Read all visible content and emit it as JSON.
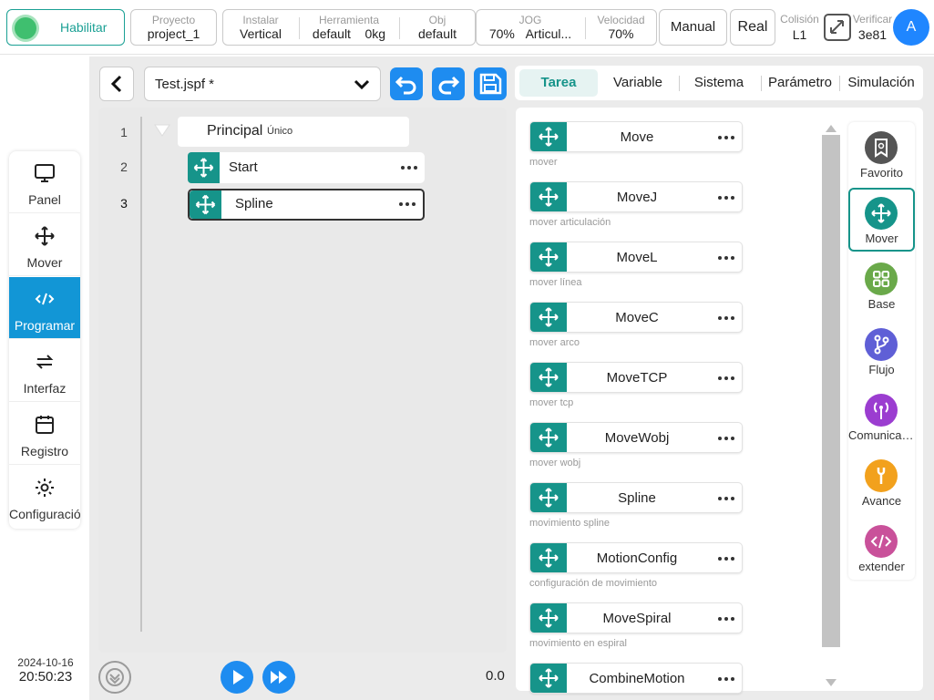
{
  "topbar": {
    "enable_label": "Habilitar",
    "project": {
      "label": "Proyecto",
      "value": "project_1"
    },
    "install": {
      "label": "Instalar",
      "value": "Vertical"
    },
    "tool": {
      "label": "Herramienta",
      "value": "default",
      "weight": "0kg"
    },
    "obj": {
      "label": "Obj",
      "value": "default"
    },
    "jog": {
      "label": "JOG",
      "value": "70%",
      "mode": "Articul..."
    },
    "speed": {
      "label": "Velocidad",
      "value": "70%"
    },
    "manual_label": "Manual",
    "real_label": "Real",
    "collision": {
      "label": "Colisión",
      "value": "L1"
    },
    "verify": {
      "label": "Verificar",
      "value": "3e81"
    },
    "avatar_letter": "A"
  },
  "leftnav": {
    "items": [
      {
        "label": "Panel",
        "icon": "monitor-icon"
      },
      {
        "label": "Mover",
        "icon": "move-icon"
      },
      {
        "label": "Programar",
        "icon": "code-icon",
        "active": true
      },
      {
        "label": "Interfaz",
        "icon": "swap-icon"
      },
      {
        "label": "Registro",
        "icon": "calendar-icon"
      },
      {
        "label": "Configuración",
        "icon": "gear-icon"
      }
    ],
    "date": "2024-10-16",
    "time": "20:50:23"
  },
  "editor": {
    "file_name": "Test.jspf *",
    "line_numbers": [
      "1",
      "2",
      "3"
    ],
    "root": {
      "name": "Principal",
      "tag": "Único"
    },
    "nodes": [
      {
        "name": "Start"
      },
      {
        "name": "Spline",
        "selected": true
      }
    ],
    "speed_value": "0.0"
  },
  "tabs": [
    "Tarea",
    "Variable",
    "Sistema",
    "Parámetro",
    "Simulación"
  ],
  "commands": [
    {
      "name": "Move",
      "desc": "mover"
    },
    {
      "name": "MoveJ",
      "desc": "mover articulación"
    },
    {
      "name": "MoveL",
      "desc": "mover línea"
    },
    {
      "name": "MoveC",
      "desc": "mover arco"
    },
    {
      "name": "MoveTCP",
      "desc": "mover tcp"
    },
    {
      "name": "MoveWobj",
      "desc": "mover wobj"
    },
    {
      "name": "Spline",
      "desc": "movimiento spline"
    },
    {
      "name": "MotionConfig",
      "desc": "configuración de movimiento"
    },
    {
      "name": "MoveSpiral",
      "desc": "movimiento en espiral"
    },
    {
      "name": "CombineMotion",
      "desc": ""
    }
  ],
  "categories": [
    {
      "label": "Favorito",
      "color": "#555555",
      "icon": "bookmark-icon"
    },
    {
      "label": "Mover",
      "color": "#16948a",
      "icon": "move-icon",
      "active": true
    },
    {
      "label": "Base",
      "color": "#6aa94a",
      "icon": "grid-icon"
    },
    {
      "label": "Flujo",
      "color": "#5f5fd6",
      "icon": "branch-icon"
    },
    {
      "label": "Comunicación",
      "color": "#9b3dd0",
      "icon": "antenna-icon"
    },
    {
      "label": "Avance",
      "color": "#f2a11d",
      "icon": "wrench-icon"
    },
    {
      "label": "extender",
      "color": "#c9519a",
      "icon": "code-icon"
    }
  ],
  "colors": {
    "accent": "#16948a",
    "primary_blue": "#1e8cf0",
    "nav_active": "#1296d6"
  }
}
